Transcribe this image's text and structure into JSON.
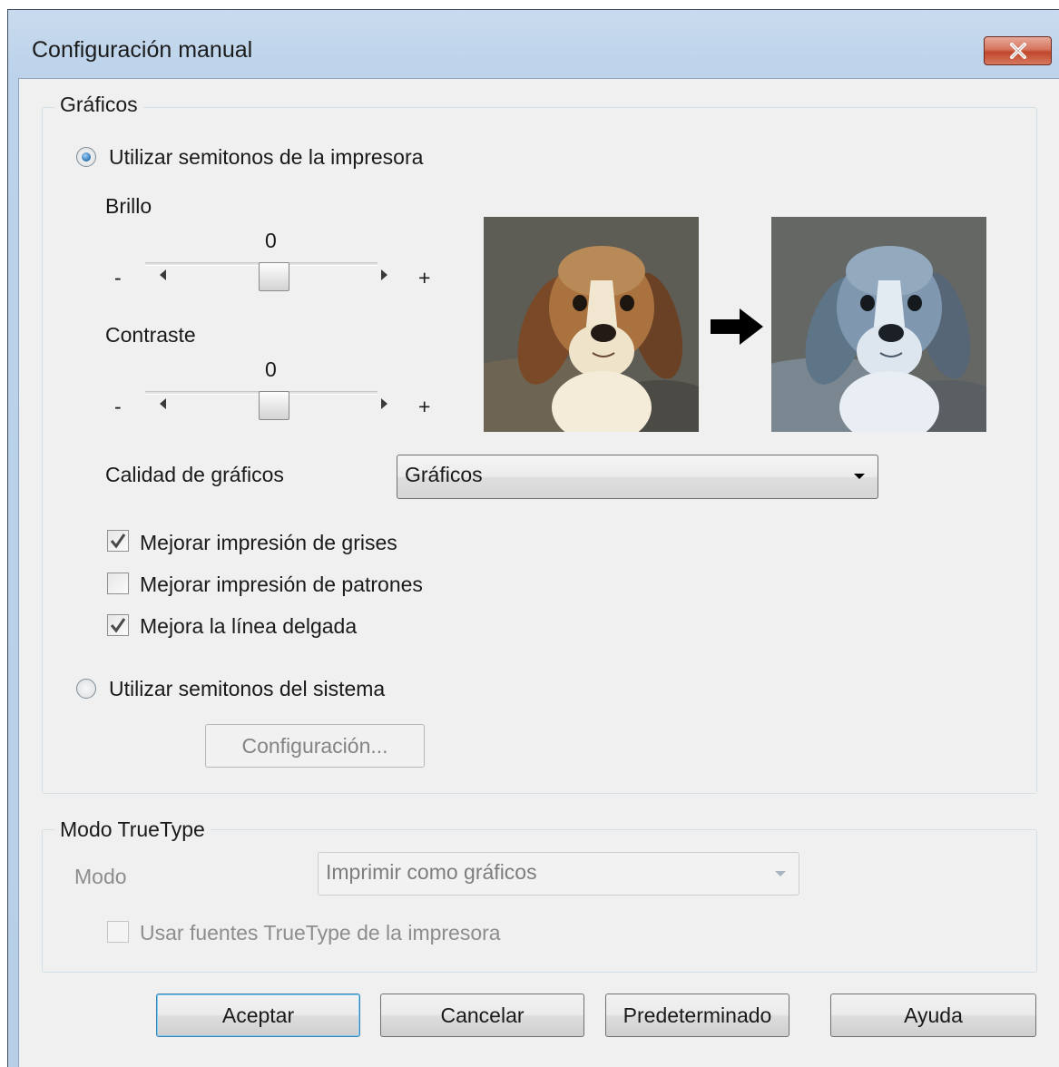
{
  "window": {
    "title": "Configuración manual",
    "close_label": "✕"
  },
  "graphics_group": {
    "title": "Gráficos",
    "printer_halftone_label": "Utilizar semitonos de la impresora",
    "brightness": {
      "label": "Brillo",
      "value": "0",
      "min_label": "-",
      "max_label": "+",
      "level": 0
    },
    "contrast": {
      "label": "Contraste",
      "value": "0",
      "min_label": "-",
      "max_label": "+",
      "level": 0
    },
    "quality_label": "Calidad de gráficos",
    "quality_value": "Gráficos",
    "checkboxes": [
      {
        "label": "Mejorar impresión de grises",
        "checked": true
      },
      {
        "label": "Mejorar impresión de patrones",
        "checked": false
      },
      {
        "label": "Mejora la línea delgada",
        "checked": true
      }
    ],
    "system_halftone_label": "Utilizar semitonos del sistema",
    "settings_button": "Configuración..."
  },
  "truetype_group": {
    "title": "Modo TrueType",
    "mode_label": "Modo",
    "mode_value": "Imprimir como gráficos",
    "printer_fonts_label": "Usar fuentes TrueType de la impresora"
  },
  "buttons": {
    "ok": "Aceptar",
    "cancel": "Cancelar",
    "default": "Predeterminado",
    "help": "Ayuda"
  },
  "colors": {
    "accent": "#2a6fb0",
    "close": "#c0472b",
    "window_frame": "#bcd3ea",
    "dialog_bg": "#f0f0f0"
  },
  "icons": {
    "close": "close-icon",
    "arrow": "right-arrow-icon",
    "check": "checkmark-icon"
  }
}
